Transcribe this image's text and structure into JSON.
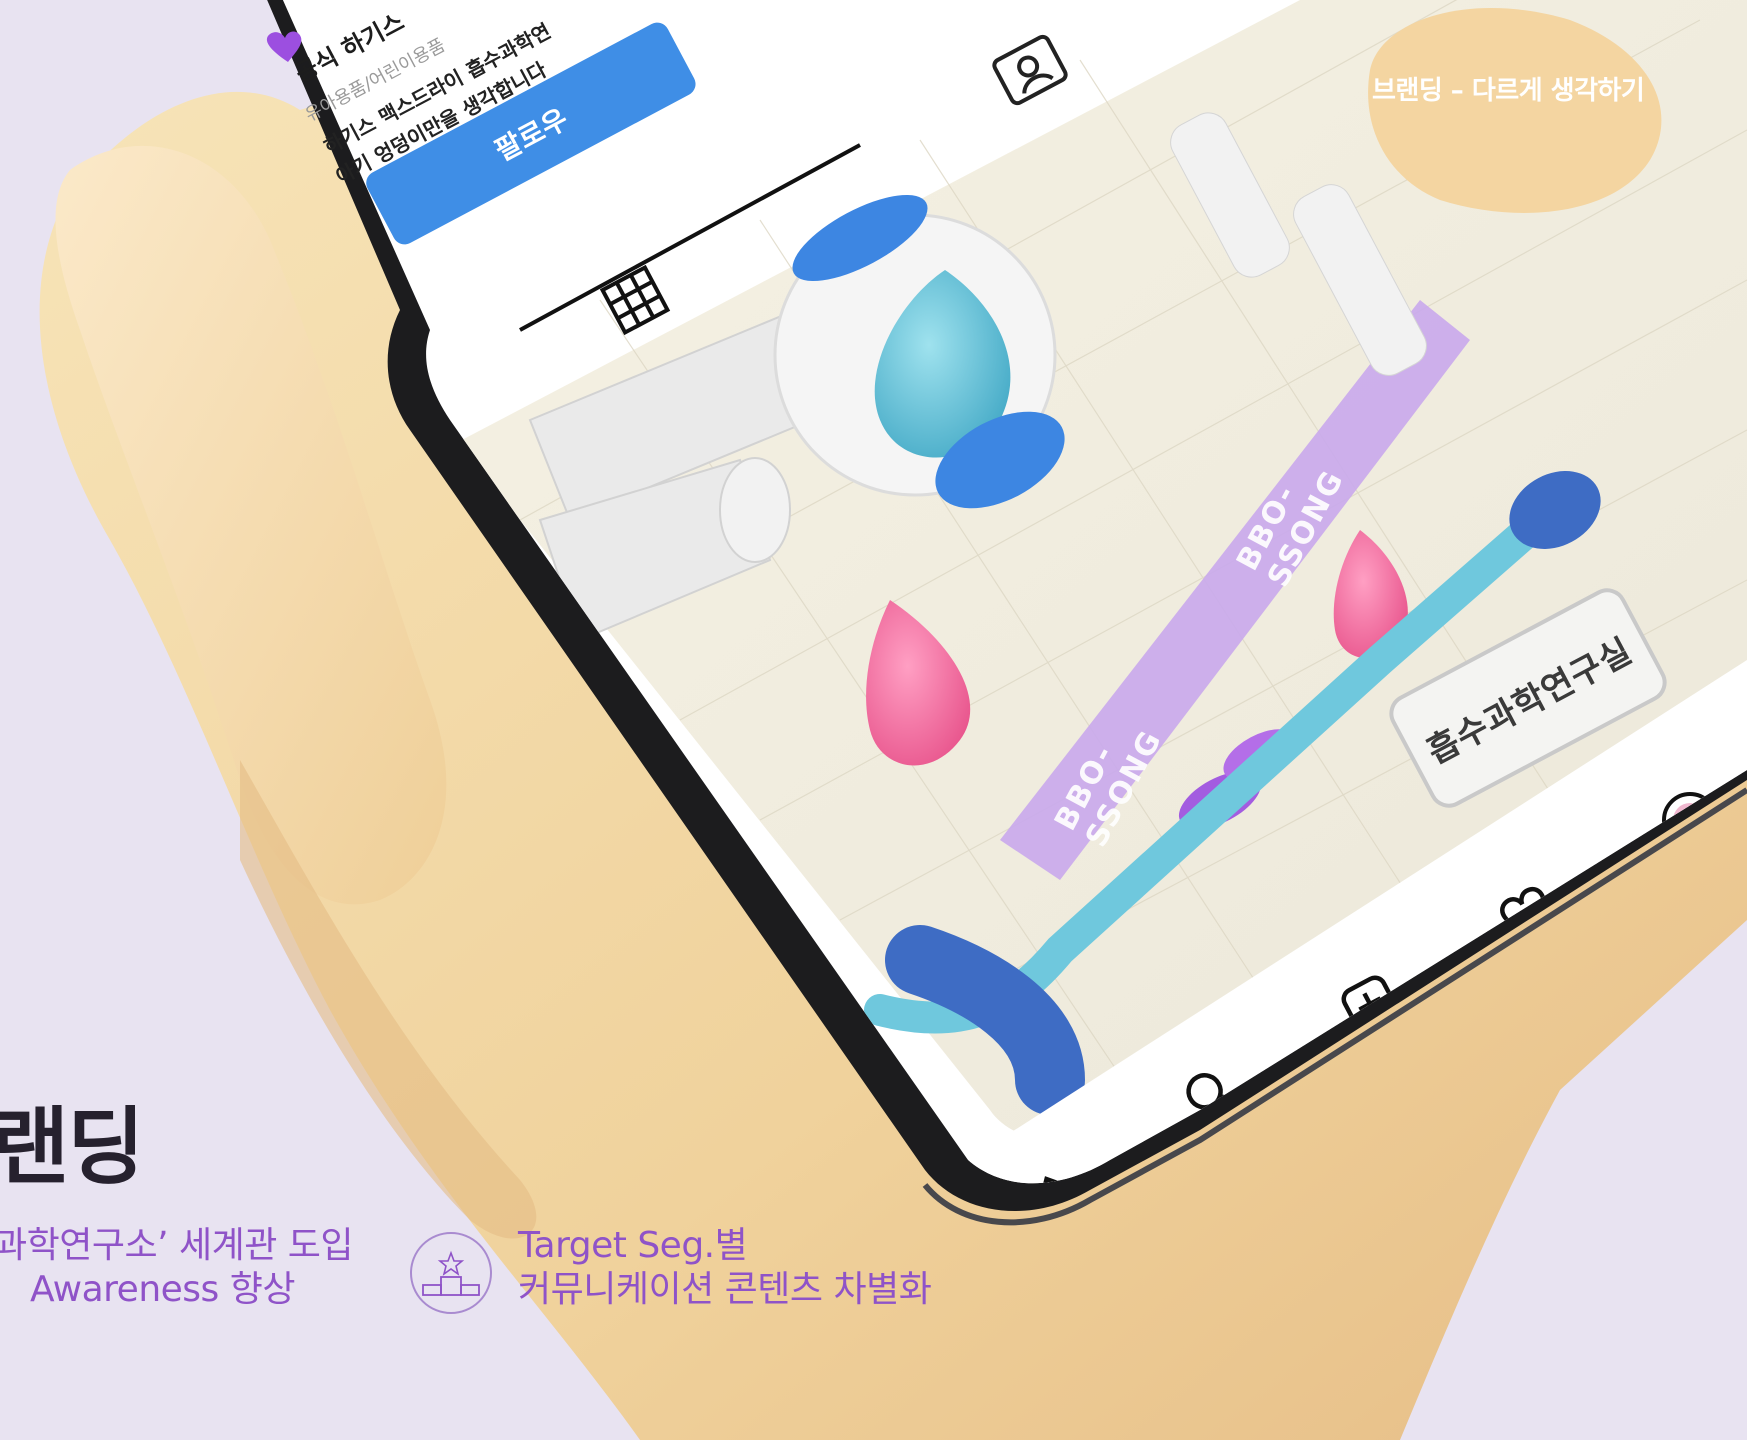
{
  "header": {
    "tagline": "브랜딩 – 다르게 생각하기"
  },
  "section": {
    "title": "랜딩"
  },
  "features": [
    {
      "lines": [
        "과학연구소’ 세계관 도입",
        "Awareness 향상"
      ],
      "icon": ""
    },
    {
      "lines": [
        "Target Seg.별",
        "커뮤니케이션 콘텐츠 차별화"
      ],
      "icon": "podium-star-icon"
    }
  ],
  "phone": {
    "profile": {
      "name": "공식 하기스",
      "category": "유아용품/어린이용품",
      "bio_line1": "하기스 맥스드라이 흡수과학연",
      "bio_line2": "아기 엉덩이만을 생각합니다",
      "follow_label": "팔로우"
    },
    "post": {
      "beam_label": "BBO-SSONG",
      "sign_label": "흡수과학연구실"
    },
    "icons": {
      "grid": "grid-icon",
      "tagged": "tagged-person-icon",
      "home": "home-icon",
      "search": "search-icon",
      "add": "add-post-icon",
      "heart": "heart-icon",
      "profile": "avatar-icon"
    }
  },
  "colors": {
    "background": "#e8e3f1",
    "accent_purple": "#8f53c8",
    "title_dark": "#26212e",
    "follow_blue": "#3f8ee6",
    "backdrop_red": "#d9362b",
    "hand_skin": "#f2d7a3"
  }
}
